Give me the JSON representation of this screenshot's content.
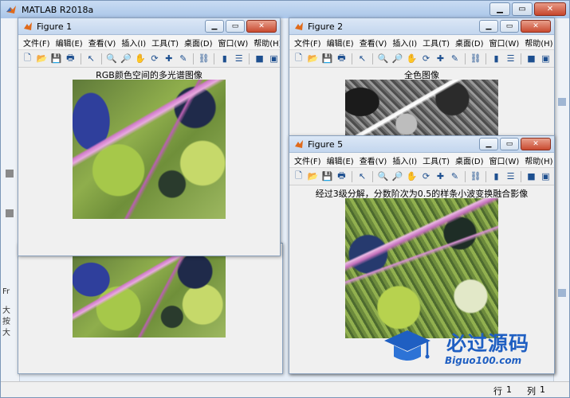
{
  "main_window": {
    "title": "MATLAB R2018a",
    "status": {
      "row_label": "行",
      "row_value": "1",
      "col_label": "列",
      "col_value": "1"
    },
    "left_strip_chars": [
      "Fr",
      "大",
      "按",
      "大"
    ]
  },
  "menu": [
    "文件(F)",
    "编辑(E)",
    "查看(V)",
    "插入(I)",
    "工具(T)",
    "桌面(D)",
    "窗口(W)",
    "帮助(H)"
  ],
  "figures": [
    {
      "title": "Figure 1",
      "plot_title": "RGB颜色空间的多光谱图像"
    },
    {
      "title": "Figure 2",
      "plot_title": "全色图像"
    },
    {
      "title": "Figure 5",
      "plot_title": "经过3级分解，分数阶次为0.5的样条小波变换融合影像"
    }
  ],
  "watermark": {
    "cn": "必过源码",
    "en": "Biguo100.com"
  }
}
